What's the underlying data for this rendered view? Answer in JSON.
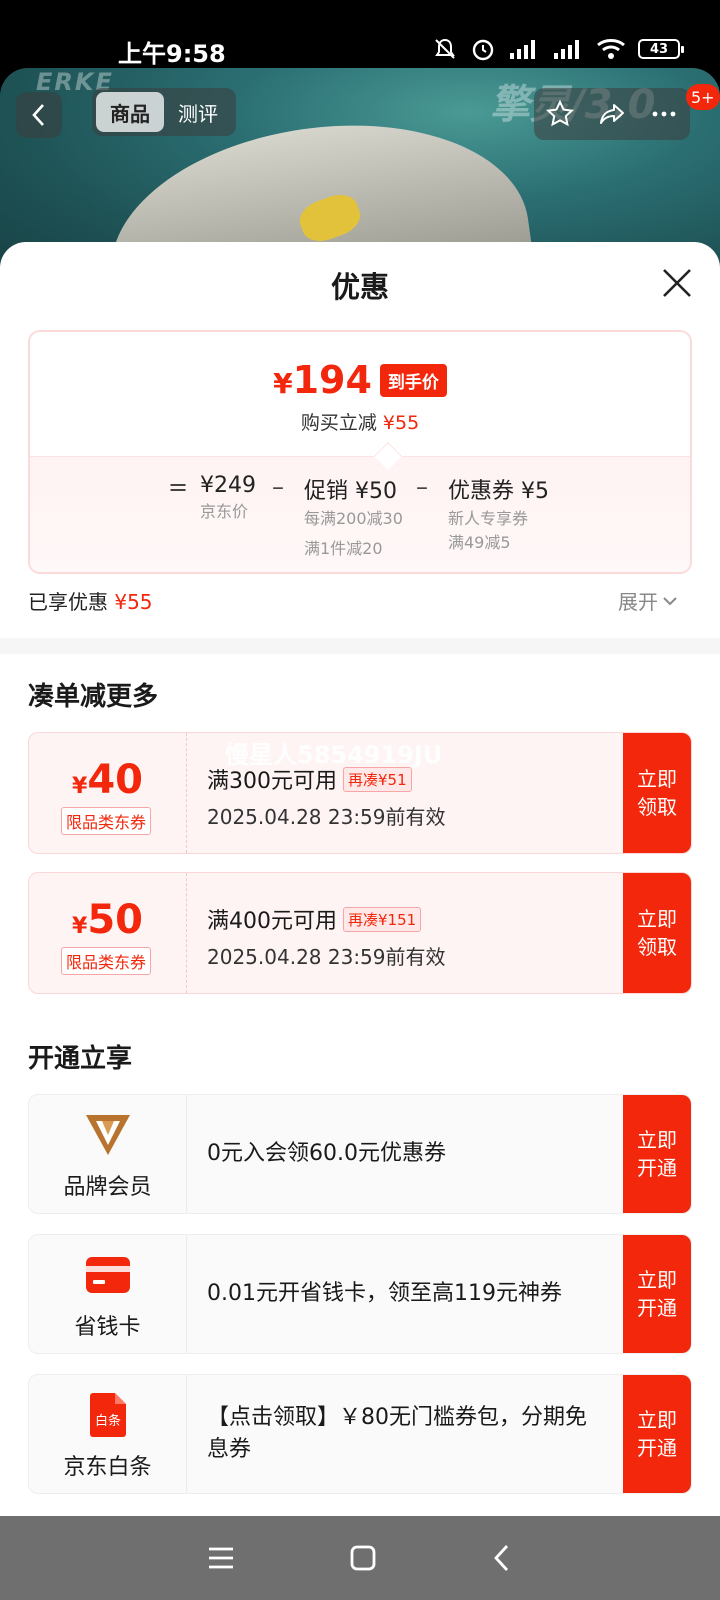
{
  "status_bar": {
    "time": "上午9:58",
    "battery": "43"
  },
  "header": {
    "brand": "ERKE",
    "model": "擎灵/3.0",
    "tabs": [
      {
        "label": "商品",
        "active": true
      },
      {
        "label": "测评",
        "active": false
      }
    ],
    "badge": "5+"
  },
  "sheet": {
    "title": "优惠",
    "price_card": {
      "currency": "¥",
      "final_price": "194",
      "final_tag": "到手价",
      "reduce_label": "购买立减",
      "reduce_value": "¥55",
      "equals": "=",
      "minus": "–",
      "base_main": "¥249",
      "base_sub": "京东价",
      "promo_main": "促销 ¥50",
      "promo_sub1": "每满200减30",
      "promo_sub2": "满1件减20",
      "coupon_main": "优惠券 ¥5",
      "coupon_sub1": "新人专享券",
      "coupon_sub2": "满49减5"
    },
    "enjoyed_label": "已享优惠",
    "enjoyed_value": "¥55",
    "expand_label": "展开",
    "section_more": "凑单减更多",
    "watermark": "慢星人5854919JU",
    "coupons": [
      {
        "currency": "¥",
        "amount": "40",
        "category": "限品类东券",
        "condition": "满300元可用",
        "extra": "再凑¥51",
        "validity": "2025.04.28 23:59前有效",
        "action": "立即领取"
      },
      {
        "currency": "¥",
        "amount": "50",
        "category": "限品类东券",
        "condition": "满400元可用",
        "extra": "再凑¥151",
        "validity": "2025.04.28 23:59前有效",
        "action": "立即领取"
      }
    ],
    "section_open": "开通立享",
    "benefits": [
      {
        "name": "品牌会员",
        "icon": "brand-member-icon",
        "desc": "0元入会领60.0元优惠券",
        "action": "立即开通"
      },
      {
        "name": "省钱卡",
        "icon": "saving-card-icon",
        "desc": "0.01元开省钱卡，领至高119元神券",
        "action": "立即开通"
      },
      {
        "name": "京东白条",
        "icon": "baitiao-icon",
        "icon_text": "白条",
        "desc": "【点击领取】￥80无门槛券包，分期免息券",
        "action": "立即开通"
      }
    ]
  },
  "colors": {
    "accent": "#f2270c",
    "coupon_bg": "#fff4f4",
    "member_gold": "#b8742e"
  }
}
